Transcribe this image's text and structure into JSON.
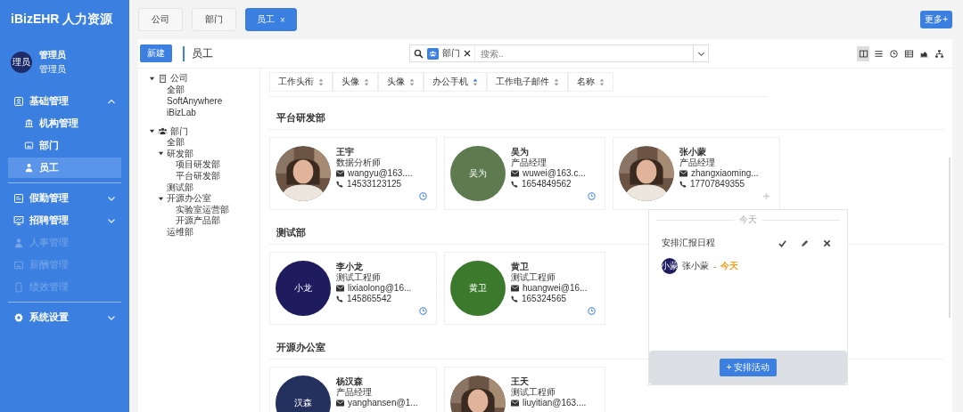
{
  "app": {
    "title": "iBizEHR 人力资源"
  },
  "user": {
    "avatar": "理员",
    "name": "管理员",
    "role": "管理员"
  },
  "menu": [
    {
      "label": "基础管理",
      "expanded": true,
      "disabled": false,
      "children": [
        {
          "label": "机构管理",
          "selected": false
        },
        {
          "label": "部门",
          "selected": false
        },
        {
          "label": "员工",
          "selected": true
        }
      ]
    },
    {
      "label": "假勤管理",
      "expanded": false,
      "disabled": false
    },
    {
      "label": "招聘管理",
      "expanded": false,
      "disabled": false
    },
    {
      "label": "人事管理",
      "disabled": true
    },
    {
      "label": "薪酬管理",
      "disabled": true
    },
    {
      "label": "绩效管理",
      "disabled": true
    },
    {
      "label": "系统设置",
      "expanded": false,
      "disabled": false
    }
  ],
  "tabs": [
    {
      "label": "公司",
      "selected": false
    },
    {
      "label": "部门",
      "selected": false
    },
    {
      "label": "员工",
      "selected": true,
      "close": "×"
    }
  ],
  "more_button": "更多+",
  "toolbar": {
    "new_button": "新建",
    "title": "员工"
  },
  "search": {
    "tag": "部门",
    "placeholder": "搜索.."
  },
  "views": [
    {
      "selected": true
    },
    {
      "selected": false
    },
    {
      "selected": false
    },
    {
      "selected": false
    },
    {
      "selected": false
    },
    {
      "selected": false
    }
  ],
  "tree": [
    {
      "label": "公司",
      "expanded": true,
      "children": [
        {
          "label": "全部"
        },
        {
          "label": "SoftAnywhere"
        },
        {
          "label": "iBizLab"
        }
      ]
    },
    {
      "label": "部门",
      "expanded": true,
      "children": [
        {
          "label": "全部"
        },
        {
          "label": "研发部",
          "expanded": true,
          "children": [
            {
              "label": "项目研发部"
            },
            {
              "label": "平台研发部"
            }
          ]
        },
        {
          "label": "测试部"
        },
        {
          "label": "开源办公室",
          "expanded": true,
          "children": [
            {
              "label": "实验室运营部"
            },
            {
              "label": "开源产品部"
            }
          ]
        },
        {
          "label": "运维部"
        }
      ]
    }
  ],
  "sort_columns": [
    {
      "label": "工作头衔",
      "sorted": false
    },
    {
      "label": "头像",
      "sorted": false
    },
    {
      "label": "头像",
      "sorted": false
    },
    {
      "label": "办公手机",
      "sorted": true
    },
    {
      "label": "工作电子邮件",
      "sorted": false
    },
    {
      "label": "名称",
      "sorted": false
    }
  ],
  "groups": [
    {
      "title": "平台研发部",
      "cards": [
        {
          "name": "王宇",
          "job": "数据分析师",
          "email": "wangyu@163....",
          "phone": "14533123125",
          "schedule_open": false
        },
        {
          "avatar": {
            "kind": "initials",
            "text": "吴为",
            "color": "#5e7b4f"
          },
          "name": "吴为",
          "job": "产品经理",
          "email": "wuwei@163.c...",
          "phone": "1654849562",
          "schedule_open": false
        },
        {
          "name": "张小蒙",
          "job": "产品经理",
          "email": "zhangxiaoming...",
          "phone": "17707849355",
          "schedule_open": true
        }
      ]
    },
    {
      "title": "测试部",
      "cards": [
        {
          "avatar": {
            "kind": "initials",
            "text": "小龙",
            "color": "#1e1b5e"
          },
          "name": "李小龙",
          "job": "测试工程师",
          "email": "lixiaolong@16...",
          "phone": "145865542",
          "schedule_open": false
        },
        {
          "avatar": {
            "kind": "initials",
            "text": "黄卫",
            "color": "#3b7a2c"
          },
          "name": "黄卫",
          "job": "测试工程师",
          "email": "huangwei@16...",
          "phone": "165324565",
          "schedule_open": false
        }
      ]
    },
    {
      "title": "开源办公室",
      "cards": [
        {
          "avatar": {
            "kind": "initials",
            "text": "汉森",
            "color": "#24305e"
          },
          "name": "杨汉森",
          "job": "产品经理",
          "email": "yanghansen@1..."
        },
        {
          "name": "王天",
          "job": "测试工程师",
          "email": "liuyitian@163...."
        }
      ]
    }
  ],
  "popover": {
    "day": "今天",
    "task": "安排汇报日程",
    "avatar": "小蒙",
    "person": "张小蒙",
    "separator": "-",
    "when": "今天",
    "button": "+ 安排活动"
  }
}
